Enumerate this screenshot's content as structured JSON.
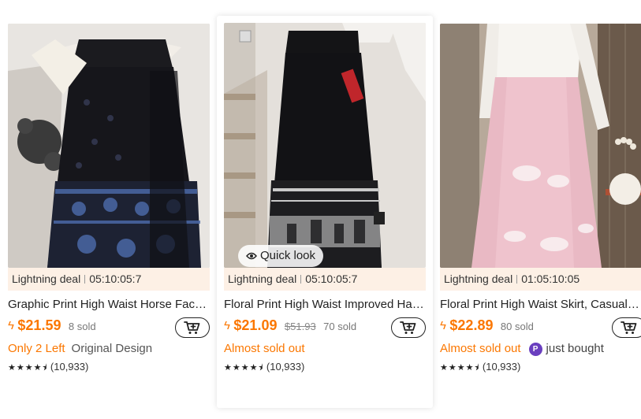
{
  "products": [
    {
      "deal_label": "Lightning deal",
      "countdown": "05:10:05:7",
      "title": "Graphic Print High Waist Horse Face Skirt",
      "price": "$21.59",
      "original_price": "",
      "sold": "8 sold",
      "tag_primary": "Only 2 Left",
      "tag_secondary": "Original Design",
      "rating_stars": "★★★★⯨",
      "reviews": "(10,933)"
    },
    {
      "deal_label": "Lightning deal",
      "countdown": "05:10:05:7",
      "title": "Floral Print High Waist Improved Hanfu Skirt",
      "price": "$21.09",
      "original_price": "$51.93",
      "sold": "70 sold",
      "tag_primary": "Almost sold out",
      "tag_secondary": "",
      "quick_look": "Quick look",
      "rating_stars": "★★★★⯨",
      "reviews": "(10,933)"
    },
    {
      "deal_label": "Lightning deal",
      "countdown": "01:05:10:05",
      "title": "Floral Print High Waist Skirt, Casual Skirt",
      "price": "$22.89",
      "original_price": "",
      "sold": "80 sold",
      "tag_primary": "Almost sold out",
      "badge_letter": "P",
      "tag_secondary": "just bought",
      "rating_stars": "★★★★⯨",
      "reviews": "(10,933)"
    }
  ],
  "colors": {
    "accent": "#fb7701",
    "deal_bg": "#fdf0e5",
    "badge": "#6a3fbf"
  }
}
